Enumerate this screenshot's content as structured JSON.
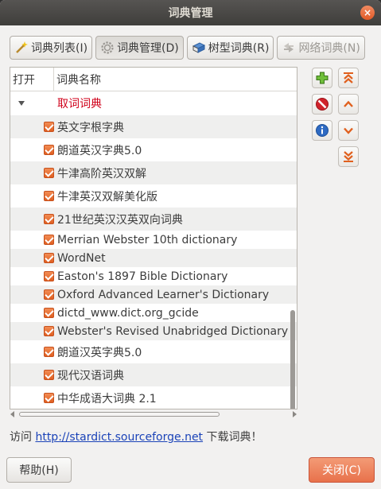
{
  "window": {
    "title": "词典管理",
    "close_glyph": "×"
  },
  "tabs": [
    {
      "label": "词典列表(I)",
      "icon": "magic-wand-icon",
      "state": "normal"
    },
    {
      "label": "词典管理(D)",
      "icon": "gear-icon",
      "state": "active"
    },
    {
      "label": "树型词典(R)",
      "icon": "book-icon",
      "state": "normal"
    },
    {
      "label": "网络词典(N)",
      "icon": "globe-icon",
      "state": "disabled"
    }
  ],
  "list": {
    "columns": [
      "打开",
      "词典名称"
    ],
    "group": {
      "label": "取词词典",
      "expanded": true
    },
    "items": [
      {
        "name": "英文字根字典",
        "checked": true
      },
      {
        "name": "朗道英汉字典5.0",
        "checked": true
      },
      {
        "name": "牛津高阶英汉双解",
        "checked": true
      },
      {
        "name": "牛津英汉双解美化版",
        "checked": true
      },
      {
        "name": "21世纪英汉汉英双向词典",
        "checked": true
      },
      {
        "name": "Merrian Webster 10th dictionary",
        "checked": true
      },
      {
        "name": "WordNet",
        "checked": true
      },
      {
        "name": "Easton's 1897 Bible Dictionary",
        "checked": true
      },
      {
        "name": "Oxford Advanced Learner's Dictionary",
        "checked": true
      },
      {
        "name": "dictd_www.dict.org_gcide",
        "checked": true
      },
      {
        "name": "Webster's Revised Unabridged Dictionary (",
        "checked": true
      },
      {
        "name": "朗道汉英字典5.0",
        "checked": true
      },
      {
        "name": "现代汉语词典",
        "checked": true
      },
      {
        "name": "中华成语大词典 2.1",
        "checked": true
      }
    ]
  },
  "side_buttons": [
    {
      "name": "add-button",
      "icon": "plus-icon"
    },
    {
      "name": "move-top-button",
      "icon": "double-chevron-up-icon"
    },
    {
      "name": "remove-button",
      "icon": "no-entry-icon"
    },
    {
      "name": "move-up-button",
      "icon": "chevron-up-icon"
    },
    {
      "name": "info-button",
      "icon": "info-icon"
    },
    {
      "name": "move-down-button",
      "icon": "chevron-down-icon"
    },
    {
      "name": "move-bottom-button",
      "icon": "double-chevron-down-icon"
    }
  ],
  "footer": {
    "prefix": "访问 ",
    "link": "http://stardict.sourceforge.net",
    "suffix": " 下载词典！"
  },
  "buttons": {
    "help": "帮助(H)",
    "close": "关闭(C)"
  },
  "colors": {
    "accent": "#e8714b",
    "group_text": "#d0021b",
    "link": "#1b43b8",
    "plus": "#5ea131",
    "info": "#2e6ac2",
    "remove": "#d0232b"
  }
}
